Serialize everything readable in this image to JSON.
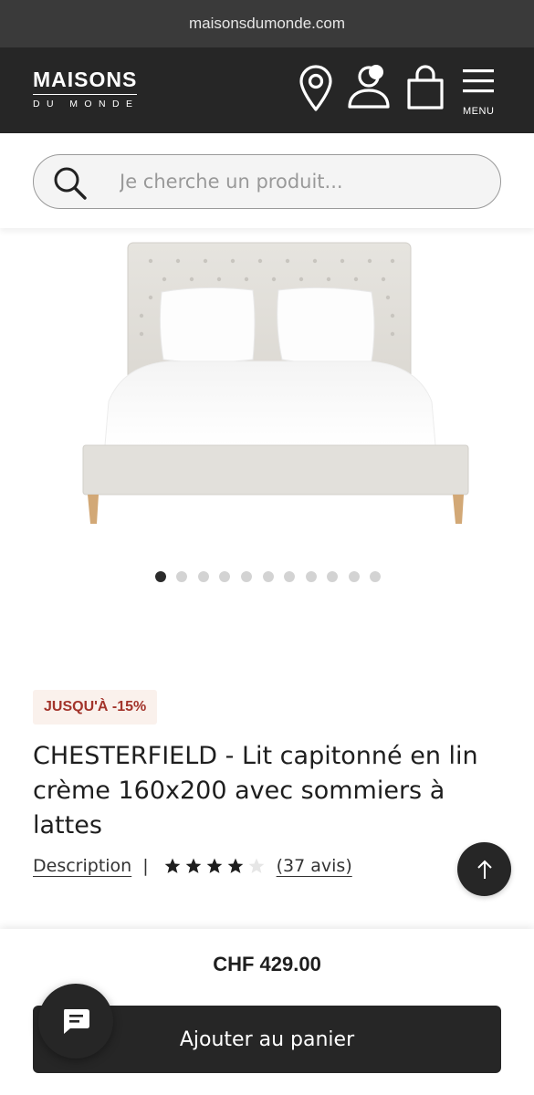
{
  "browser": {
    "url": "maisonsdumonde.com"
  },
  "header": {
    "logo_main": "MAISONS",
    "logo_sub": "DU MONDE",
    "icons": [
      "location-pin-icon",
      "account-icon",
      "shopping-bag-icon",
      "hamburger-menu-icon"
    ],
    "menu_label": "MENU"
  },
  "search": {
    "placeholder": "Je cherche un produit..."
  },
  "gallery": {
    "image_count": 11,
    "active_index": 0
  },
  "product": {
    "badge": "JUSQU'À -15%",
    "title": "CHESTERFIELD - Lit capitonné en lin crème 160x200 avec sommiers à lattes",
    "description_link": "Description",
    "separator": "|",
    "rating": 4,
    "rating_max": 5,
    "reviews": "(37 avis)",
    "price": "CHF 429.00"
  },
  "actions": {
    "add_to_cart": "Ajouter au panier"
  },
  "colors": {
    "header_bg": "#262626",
    "badge_text": "#a3342b",
    "badge_bg": "#faf1ec"
  }
}
